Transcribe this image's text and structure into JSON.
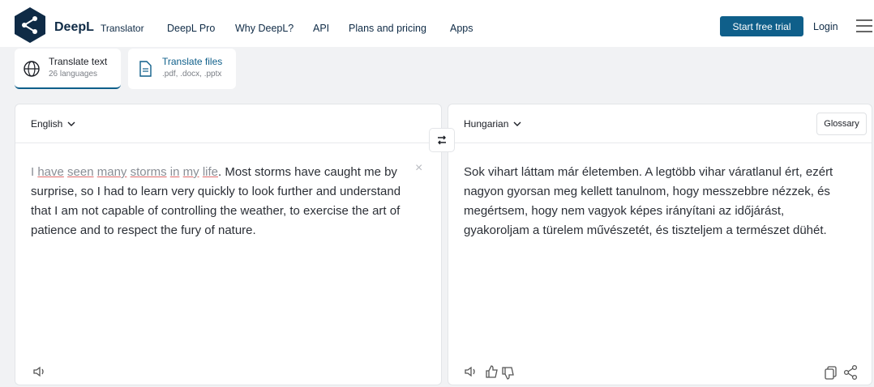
{
  "header": {
    "brand": "DeepL",
    "brand_sub": "Translator",
    "nav": [
      "DeepL Pro",
      "Why DeepL?",
      "API",
      "Plans and pricing",
      "Apps"
    ],
    "cta": "Start free trial",
    "login": "Login"
  },
  "modes": [
    {
      "title": "Translate text",
      "sub": "26 languages"
    },
    {
      "title": "Translate files",
      "sub": ".pdf, .docx, .pptx"
    }
  ],
  "source": {
    "language": "English",
    "words_underlined": [
      "have",
      "seen",
      "many",
      "storms",
      "in",
      "my",
      "life"
    ],
    "prefix": "I",
    "rest": ". Most storms have caught me by surprise, so I had to learn very quickly to look further and understand that I am not capable of controlling the weather, to exercise the art of patience and to respect the fury of nature.",
    "clear": "×"
  },
  "target": {
    "language": "Hungarian",
    "glossary": "Glossary",
    "text": "Sok vihart láttam már életemben. A legtöbb vihar váratlanul ért, ezért nagyon gyorsan meg kellett tanulnom, hogy messzebbre nézzek, és megértsem, hogy nem vagyok képes irányítani az időjárást, gyakoroljam a türelem művészetét, és tiszteljem a természet dühét."
  },
  "colors": {
    "accent": "#0f5f8a",
    "brand_dark": "#0f2b46"
  },
  "icons": [
    "deepl-logo-icon",
    "globe-icon",
    "file-icon",
    "chevron-down-icon",
    "swap-icon",
    "speaker-icon",
    "thumbs-up-icon",
    "thumbs-down-icon",
    "copy-icon",
    "share-icon",
    "menu-icon"
  ]
}
